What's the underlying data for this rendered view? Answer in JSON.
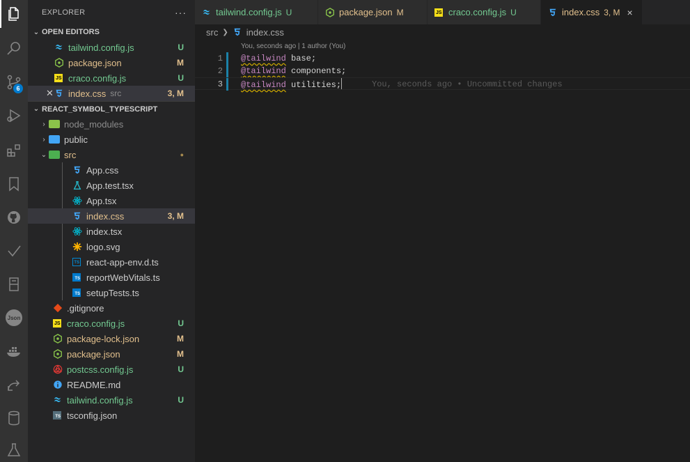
{
  "activity_bar": {
    "items": [
      {
        "name": "explorer",
        "icon": "files-icon"
      },
      {
        "name": "search",
        "icon": "search-icon"
      },
      {
        "name": "source-control",
        "icon": "source-control-icon",
        "badge": "6"
      },
      {
        "name": "run-debug",
        "icon": "debug-icon"
      },
      {
        "name": "extensions",
        "icon": "extensions-icon"
      },
      {
        "name": "bookmarks",
        "icon": "bookmark-icon"
      },
      {
        "name": "github",
        "icon": "github-icon"
      },
      {
        "name": "todo",
        "icon": "check-icon"
      },
      {
        "name": "remote",
        "icon": "remote-explorer-icon"
      },
      {
        "name": "json",
        "icon": "json-icon",
        "label": "Json"
      },
      {
        "name": "docker",
        "icon": "docker-icon"
      },
      {
        "name": "live-share",
        "icon": "live-share-icon"
      },
      {
        "name": "database",
        "icon": "database-icon"
      },
      {
        "name": "testing",
        "icon": "flask-icon"
      }
    ]
  },
  "explorer": {
    "title": "EXPLORER",
    "more": "···",
    "open_editors": {
      "label": "OPEN EDITORS",
      "items": [
        {
          "label": "tailwind.config.js",
          "status": "U",
          "icon": "tailwind-icon"
        },
        {
          "label": "package.json",
          "status": "M",
          "icon": "node-icon"
        },
        {
          "label": "craco.config.js",
          "status": "U",
          "icon": "js-icon"
        },
        {
          "label": "index.css",
          "desc": "src",
          "status": "3, M",
          "icon": "css-icon"
        }
      ]
    },
    "project": {
      "label": "REACT_SYMBOL_TYPESCRIPT",
      "items": [
        {
          "label": "node_modules",
          "icon": "folder-node-icon"
        },
        {
          "label": "public",
          "icon": "folder-public-icon"
        },
        {
          "label": "src",
          "icon": "folder-src-icon",
          "status": "●"
        },
        {
          "label": "App.css",
          "icon": "css-icon"
        },
        {
          "label": "App.test.tsx",
          "icon": "test-icon"
        },
        {
          "label": "App.tsx",
          "icon": "react-icon"
        },
        {
          "label": "index.css",
          "status": "3, M",
          "icon": "css-icon"
        },
        {
          "label": "index.tsx",
          "icon": "react-icon"
        },
        {
          "label": "logo.svg",
          "icon": "svg-icon"
        },
        {
          "label": "react-app-env.d.ts",
          "icon": "ts-def-icon"
        },
        {
          "label": "reportWebVitals.ts",
          "icon": "ts-icon"
        },
        {
          "label": "setupTests.ts",
          "icon": "ts-icon"
        },
        {
          "label": ".gitignore",
          "icon": "git-icon"
        },
        {
          "label": "craco.config.js",
          "status": "U",
          "icon": "js-icon"
        },
        {
          "label": "package-lock.json",
          "status": "M",
          "icon": "node-icon"
        },
        {
          "label": "package.json",
          "status": "M",
          "icon": "node-icon"
        },
        {
          "label": "postcss.config.js",
          "status": "U",
          "icon": "postcss-icon"
        },
        {
          "label": "README.md",
          "icon": "info-icon"
        },
        {
          "label": "tailwind.config.js",
          "status": "U",
          "icon": "tailwind-icon"
        },
        {
          "label": "tsconfig.json",
          "icon": "tsconfig-icon"
        }
      ]
    }
  },
  "tabs": [
    {
      "label": "tailwind.config.js",
      "status": "U",
      "icon": "tailwind-icon"
    },
    {
      "label": "package.json",
      "status": "M",
      "icon": "node-icon"
    },
    {
      "label": "craco.config.js",
      "status": "U",
      "icon": "js-icon"
    },
    {
      "label": "index.css",
      "status": "3, M",
      "icon": "css-icon",
      "close": "×"
    }
  ],
  "breadcrumb": {
    "folder": "src",
    "file": "index.css"
  },
  "editor": {
    "codelens": "You, seconds ago | 1 author (You)",
    "lines": [
      {
        "num": "1",
        "directive": "@tailwind",
        "arg": " base;"
      },
      {
        "num": "2",
        "directive": "@tailwind",
        "arg": " components;"
      },
      {
        "num": "3",
        "directive": "@tailwind",
        "arg": " utilities;"
      }
    ],
    "blame": "You, seconds ago • Uncommitted changes"
  },
  "colors": {
    "added": "#73c991",
    "modified": "#e2c08d",
    "accent": "#007acc"
  }
}
